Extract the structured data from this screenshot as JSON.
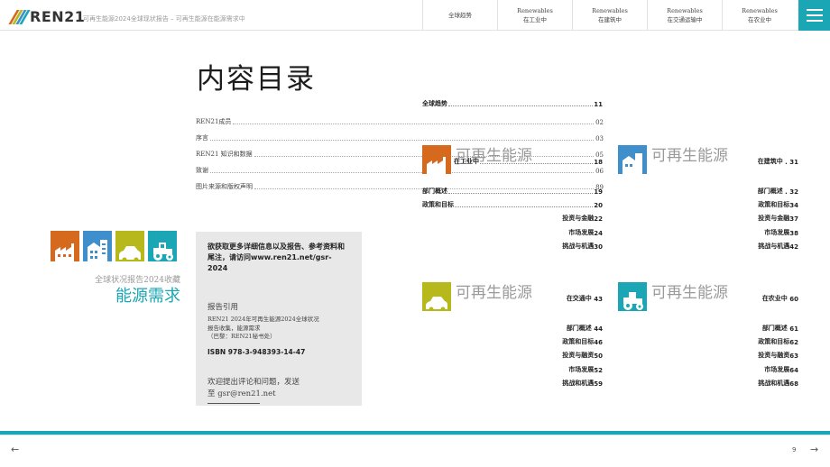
{
  "header": {
    "logo_text": "REN21",
    "subtitle": "可再生能源2024全球现状报告 – 可再生能源在能源需求中",
    "nav": [
      {
        "line1": "",
        "line2": "全球趋势"
      },
      {
        "line1": "Renewables",
        "line2": "在工业中"
      },
      {
        "line1": "Renewables",
        "line2": "在建筑中"
      },
      {
        "line1": "Renewables",
        "line2": "在交通运输中"
      },
      {
        "line1": "Renewables",
        "line2": "在农业中"
      }
    ],
    "menu_icon": "hamburger-icon"
  },
  "title": "内容目录",
  "left_toc": [
    {
      "label": "REN21成员",
      "page": "02"
    },
    {
      "label": "序言",
      "page": "03"
    },
    {
      "label": "REN21 知识和数据",
      "page": "05"
    },
    {
      "label": "致谢",
      "page": "06"
    },
    {
      "label": "图片来源和版权声明",
      "page": "89"
    }
  ],
  "left_panel": {
    "subtitle": "全球状况报告2024收藏",
    "title": "能源需求",
    "icons": [
      {
        "name": "factory-icon",
        "color": "#d56a1f"
      },
      {
        "name": "buildings-icon",
        "color": "#3e8fcb"
      },
      {
        "name": "car-icon",
        "color": "#b7b81c"
      },
      {
        "name": "tractor-icon",
        "color": "#1aa6b5"
      }
    ]
  },
  "info_box": {
    "bold_text": "欲获取更多详细信息以及报告、参考资料和尾注，请访问www.ren21.net/gsr-2024",
    "citation_heading": "报告引用",
    "citation_line1": "REN21 2024年可再生能源2024全球状况",
    "citation_line2": "报告收集，能源需求",
    "citation_line3": "（巴黎：REN21秘书处）",
    "isbn": "ISBN 978-3-948393-14-47",
    "contact_line1": "欢迎提出评论和问题，发送",
    "contact_line2": "至 gsr@ren21.net"
  },
  "global_trends": {
    "label": "全球趋势",
    "page": "11"
  },
  "watermark": "可再生能源",
  "sections": {
    "industry": {
      "heading": "在工业中",
      "page": "18",
      "items": [
        {
          "label": "部门概述",
          "page": "19"
        },
        {
          "label": "政策和目标",
          "page": "20"
        },
        {
          "label": "投资与金融",
          "page": "22"
        },
        {
          "label": "市场发展",
          "page": "24"
        },
        {
          "label": "挑战与机遇",
          "page": "30"
        }
      ]
    },
    "buildings": {
      "heading": "在建筑中",
      "page": "31",
      "items": [
        {
          "label": "部门概述",
          "page": "32"
        },
        {
          "label": "政策和目标",
          "page": "34"
        },
        {
          "label": "投资与金融",
          "page": "37"
        },
        {
          "label": "市场发展",
          "page": "38"
        },
        {
          "label": "挑战与机遇",
          "page": "42"
        }
      ]
    },
    "transport": {
      "heading": "在交通中",
      "page": "43",
      "items": [
        {
          "label": "部门概述",
          "page": "44"
        },
        {
          "label": "政策和目标",
          "page": "46"
        },
        {
          "label": "投资与融资",
          "page": "50"
        },
        {
          "label": "市场发展",
          "page": "52"
        },
        {
          "label": "挑战和机遇",
          "page": "59"
        }
      ]
    },
    "agriculture": {
      "heading": "在农业中",
      "page": "60",
      "items": [
        {
          "label": "部门概述",
          "page": "61"
        },
        {
          "label": "政策和目标",
          "page": "62"
        },
        {
          "label": "投资与融资",
          "page": "63"
        },
        {
          "label": "市场发展",
          "page": "64"
        },
        {
          "label": "挑战和机遇",
          "page": "68"
        }
      ]
    }
  },
  "footer": {
    "prev_arrow": "←",
    "next_arrow": "→",
    "page_number": "9"
  }
}
